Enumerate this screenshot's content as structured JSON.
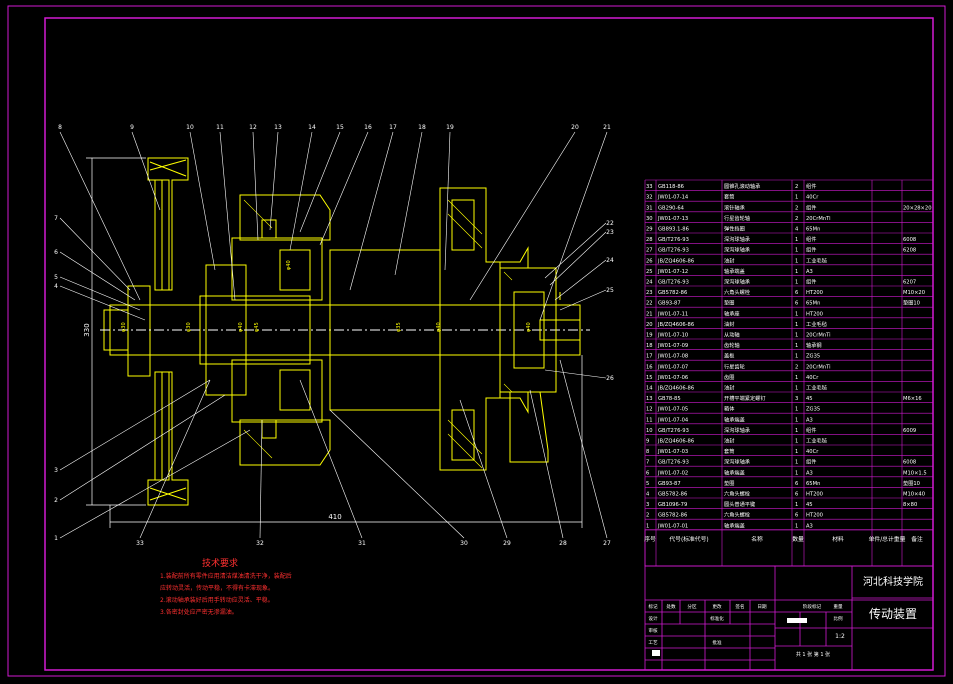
{
  "colors": {
    "background": "#000000",
    "frame": "#d21ad2",
    "geometry": "#ffff00",
    "leader": "#ffffff",
    "dimension": "#ffffff",
    "table_text": "#ffffff",
    "notes": "#ff3030",
    "title": "#ffffff"
  },
  "callouts_top": [
    "8",
    "9",
    "10",
    "11",
    "12",
    "13",
    "14",
    "15",
    "16",
    "17",
    "18",
    "19",
    "20",
    "21"
  ],
  "callouts_left": [
    "7",
    "6",
    "5",
    "4",
    "3",
    "2",
    "1"
  ],
  "callouts_right": [
    "22",
    "23",
    "24",
    "25",
    "26"
  ],
  "callouts_bottom": [
    "33",
    "32",
    "31",
    "30",
    "29",
    "28",
    "27"
  ],
  "dimensions": {
    "overall_length": "410",
    "outer_diameter": "330",
    "shaft_dia_1": "φ30",
    "shaft_dia_2": "φ40",
    "shaft_dia_3": "φ45",
    "shaft_dia_4": "φ30",
    "shaft_dia_5": "φ40",
    "shaft_dia_6": "φ35",
    "shaft_dia_7": "φ40",
    "shaft_dia_8": "φ40"
  },
  "notes": {
    "title": "技术要求",
    "lines": [
      "1.装配前所有零件应用清洁煤油清洗干净，装配后",
      "应转动灵活，传动平稳，不得有卡滞现象。",
      "2.滚动轴承装好后用手转动应灵活、平稳。",
      "3.各密封处应严密无渗漏油。"
    ]
  },
  "bom": {
    "rows": [
      [
        "33",
        "GB118-86",
        "圆锥孔滚动轴承",
        "2",
        "组件",
        ""
      ],
      [
        "32",
        "JW01-07-14",
        "套筒",
        "1",
        "40Cr",
        ""
      ],
      [
        "31",
        "GB290-64",
        "滚针轴承",
        "2",
        "组件",
        "20×28×20"
      ],
      [
        "30",
        "JW01-07-13",
        "行星齿轮轴",
        "2",
        "20CrMnTi",
        ""
      ],
      [
        "29",
        "GB893.1-86",
        "弹性挡圈",
        "4",
        "65Mn",
        ""
      ],
      [
        "28",
        "GB/T276-93",
        "深沟球轴承",
        "1",
        "组件",
        "6008"
      ],
      [
        "27",
        "GB/T276-93",
        "深沟球轴承",
        "1",
        "组件",
        "6208"
      ],
      [
        "26",
        "JB/ZQ4606-86",
        "油封",
        "1",
        "工业毛毡",
        ""
      ],
      [
        "25",
        "JW01-07-12",
        "轴承端盖",
        "1",
        "A3",
        ""
      ],
      [
        "24",
        "GB/T276-93",
        "深沟球轴承",
        "1",
        "组件",
        "6207"
      ],
      [
        "23",
        "GB5782-86",
        "六角头螺栓",
        "6",
        "HT200",
        "M10×20"
      ],
      [
        "22",
        "GB93-87",
        "垫圈",
        "6",
        "65Mn",
        "垫圈10"
      ],
      [
        "21",
        "JW01-07-11",
        "轴承座",
        "1",
        "HT200",
        ""
      ],
      [
        "20",
        "JB/ZQ4606-86",
        "油封",
        "1",
        "工业毛毡",
        ""
      ],
      [
        "19",
        "JW01-07-10",
        "从动轴",
        "1",
        "20CrMnTi",
        ""
      ],
      [
        "18",
        "JW01-07-09",
        "齿轮轴",
        "1",
        "轴承钢",
        ""
      ],
      [
        "17",
        "JW01-07-08",
        "盖板",
        "1",
        "ZG35",
        ""
      ],
      [
        "16",
        "JW01-07-07",
        "行星齿轮",
        "2",
        "20CrMnTi",
        ""
      ],
      [
        "15",
        "JW01-07-06",
        "齿圈",
        "1",
        "40Cr",
        ""
      ],
      [
        "14",
        "JB/ZQ4606-86",
        "油封",
        "1",
        "工业毛毡",
        ""
      ],
      [
        "13",
        "GB78-85",
        "开槽平端紧定螺钉",
        "3",
        "45",
        "M6×16"
      ],
      [
        "12",
        "JW01-07-05",
        "箱体",
        "1",
        "ZG35",
        ""
      ],
      [
        "11",
        "JW01-07-04",
        "轴承端盖",
        "1",
        "A3",
        ""
      ],
      [
        "10",
        "GB/T276-93",
        "深沟球轴承",
        "1",
        "组件",
        "6009"
      ],
      [
        "9",
        "JB/ZQ4606-86",
        "油封",
        "1",
        "工业毛毡",
        ""
      ],
      [
        "8",
        "JW01-07-03",
        "套筒",
        "1",
        "40Cr",
        ""
      ],
      [
        "7",
        "GB/T276-93",
        "深沟球轴承",
        "1",
        "组件",
        "6008"
      ],
      [
        "6",
        "JW01-07-02",
        "轴承端盖",
        "1",
        "A3",
        "M10×1.5"
      ],
      [
        "5",
        "GB93-87",
        "垫圈",
        "6",
        "65Mn",
        "垫圈10"
      ],
      [
        "4",
        "GB5782-86",
        "六角头螺栓",
        "6",
        "HT200",
        "M10×40"
      ],
      [
        "3",
        "GB1096-79",
        "圆头普通平键",
        "1",
        "45",
        "8×80"
      ],
      [
        "2",
        "GB5782-86",
        "六角头螺栓",
        "6",
        "HT200",
        ""
      ],
      [
        "1",
        "JW01-07-01",
        "轴承端盖",
        "1",
        "A3",
        ""
      ]
    ],
    "header": [
      "序号",
      "代号(标准代号)",
      "名称",
      "数量",
      "材料",
      "单件/总计重量",
      "备注"
    ]
  },
  "title_block": {
    "school": "河北科技学院",
    "drawing_name": "传动装置",
    "scale": "1:2",
    "sheets": "共 1 张   第 1 张",
    "labels": [
      "标记",
      "处数",
      "分区",
      "更改",
      "签名",
      "日期",
      "设计",
      "标准化",
      "审核",
      "工艺",
      "批准",
      "阶段标记",
      "重量",
      "比例"
    ]
  }
}
